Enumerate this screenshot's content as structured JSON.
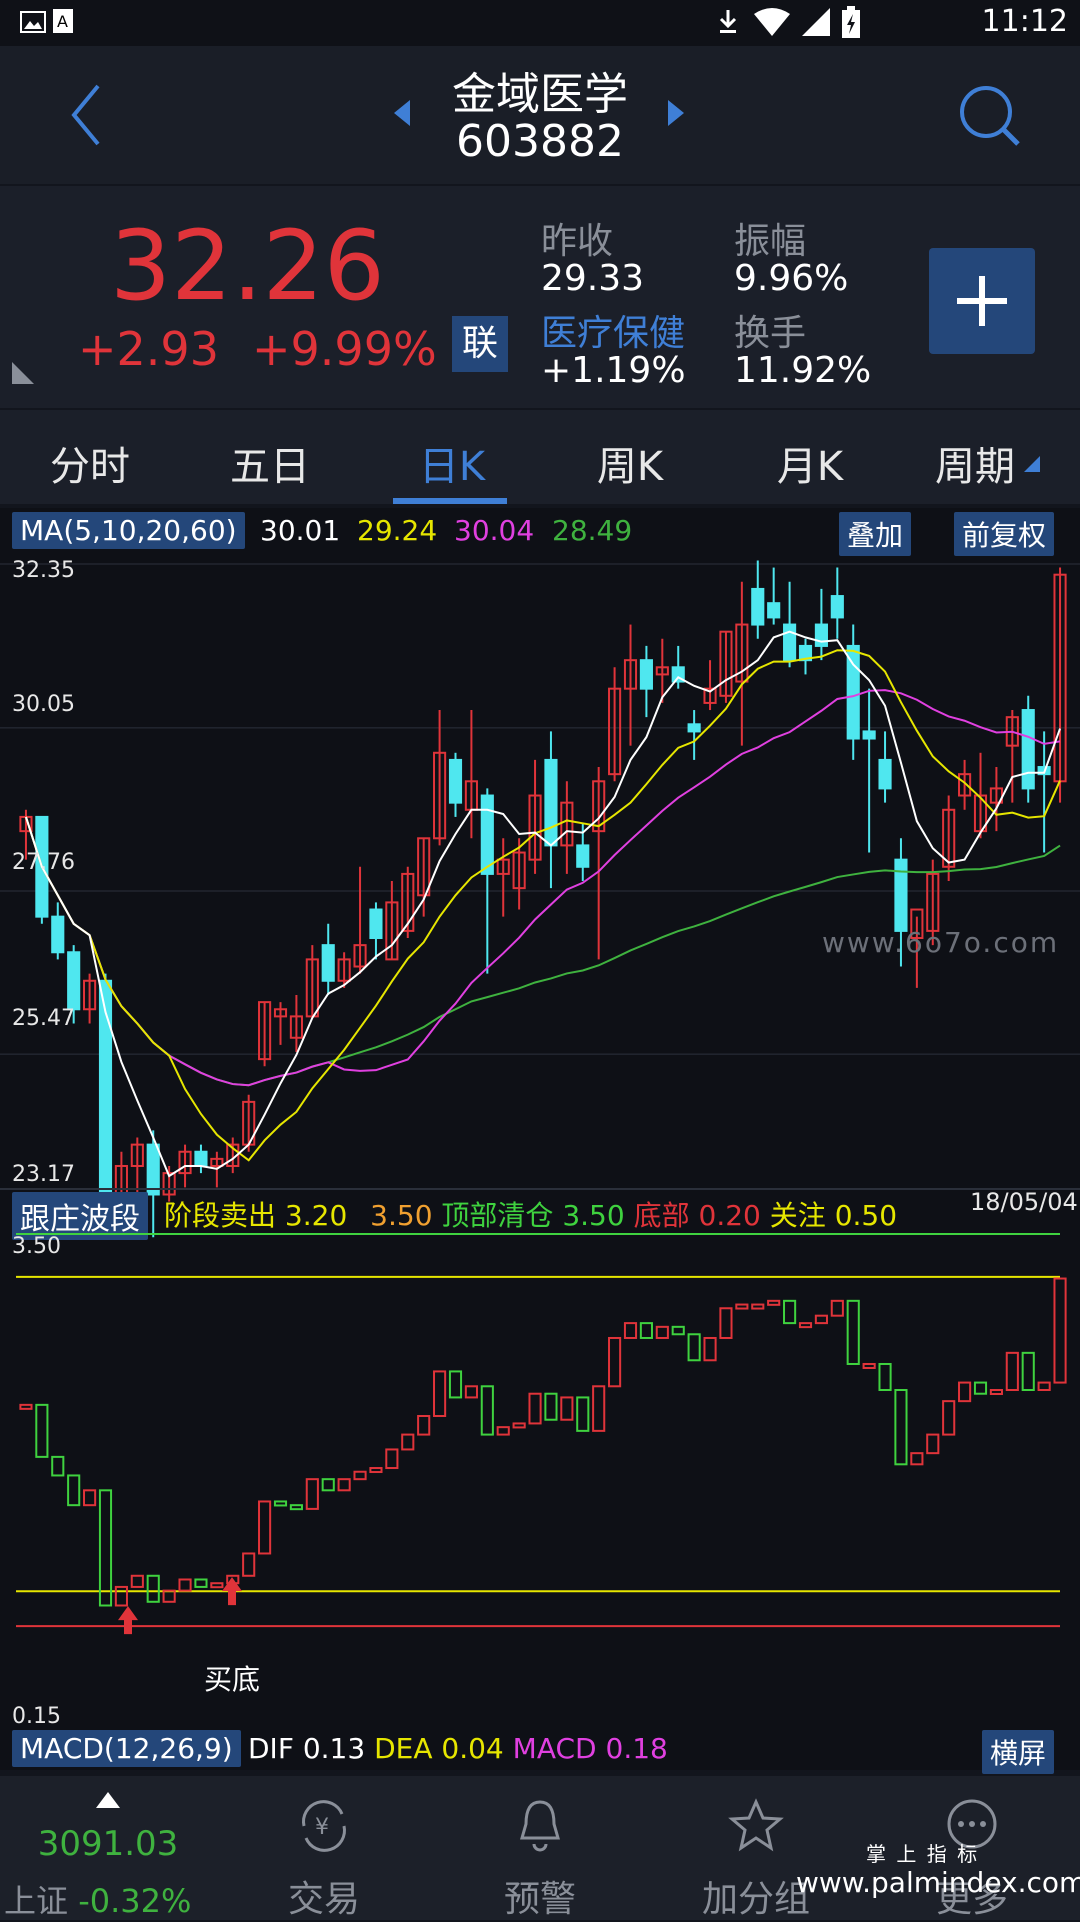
{
  "status": {
    "time": "11:12"
  },
  "header": {
    "stock_name": "金域医学",
    "stock_code": "603882"
  },
  "quote": {
    "price": "32.26",
    "change": "+2.93",
    "change_pct": "+9.99%",
    "lian_badge": "联",
    "prev_close_label": "昨收",
    "prev_close": "29.33",
    "amplitude_label": "振幅",
    "amplitude": "9.96%",
    "sector_label": "医疗保健",
    "sector_change": "+1.19%",
    "turnover_label": "换手",
    "turnover": "11.92%"
  },
  "tabs": [
    "分时",
    "五日",
    "日K",
    "周K",
    "月K",
    "周期"
  ],
  "active_tab": 2,
  "ma_bar": {
    "label": "MA(5,10,20,60)",
    "v1": "30.01",
    "v2": "29.24",
    "v3": "30.04",
    "v4": "28.49",
    "overlay_button": "叠加",
    "adjust_button": "前复权"
  },
  "price_axis": [
    "32.35",
    "30.05",
    "27.76",
    "25.47",
    "23.17"
  ],
  "watermark": "www.6o7o.com",
  "indicator_bar": {
    "label": "跟庄波段",
    "sell_label": "阶段卖出",
    "sell_a": "3.20",
    "sell_b": "3.50",
    "top_label": "顶部清仓",
    "top_val": "3.50",
    "bottom_label": "底部",
    "bottom_val": "0.20",
    "watch_label": "关注",
    "watch_val": "0.50",
    "date": "18/05/04"
  },
  "indicator_axis": [
    "3.50",
    "0.15"
  ],
  "buy_bottom_label": "买底",
  "macd_bar": {
    "label": "MACD(12,26,9)",
    "dif_label": "DIF",
    "dif": "0.13",
    "dea_label": "DEA",
    "dea": "0.04",
    "macd_label": "MACD",
    "macd": "0.18",
    "landscape_button": "横屏"
  },
  "bottom_nav": {
    "index_value": "3091.03",
    "index_name": "上证",
    "index_change": "-0.32%",
    "items": [
      "交易",
      "预警",
      "加分组",
      "更多"
    ]
  },
  "watermark_bottom": {
    "top": "掌 上 指 标",
    "url": "www.palmindex.com"
  },
  "chart_data": {
    "type": "candlestick",
    "ma_colors": {
      "ma5": "#ffffff",
      "ma10": "#e6e600",
      "ma20": "#e040e0",
      "ma60": "#3fb23f"
    },
    "up_color": "#e0343a",
    "down_color": "#4fe7ef",
    "y_range": [
      23.17,
      32.35
    ],
    "candles": [
      [
        28.6,
        28.9,
        28.2,
        28.8
      ],
      [
        28.8,
        28.8,
        27.3,
        27.4
      ],
      [
        27.4,
        27.6,
        26.8,
        26.9
      ],
      [
        26.9,
        27.0,
        25.9,
        26.1
      ],
      [
        26.1,
        26.6,
        25.9,
        26.5
      ],
      [
        26.5,
        26.6,
        22.9,
        23.4
      ],
      [
        23.4,
        24.1,
        23.0,
        23.9
      ],
      [
        23.9,
        24.3,
        23.4,
        24.2
      ],
      [
        24.2,
        24.4,
        22.9,
        23.5
      ],
      [
        23.5,
        23.9,
        23.4,
        23.8
      ],
      [
        23.8,
        24.2,
        23.6,
        24.1
      ],
      [
        24.1,
        24.2,
        23.8,
        23.9
      ],
      [
        23.9,
        24.1,
        23.6,
        24.0
      ],
      [
        23.9,
        24.3,
        23.8,
        24.2
      ],
      [
        24.2,
        24.9,
        24.1,
        24.8
      ],
      [
        25.4,
        26.2,
        25.3,
        26.2
      ],
      [
        26.0,
        26.2,
        25.6,
        26.1
      ],
      [
        25.7,
        26.3,
        25.5,
        26.0
      ],
      [
        26.0,
        27.0,
        26.0,
        26.8
      ],
      [
        27.0,
        27.3,
        26.3,
        26.5
      ],
      [
        26.5,
        26.9,
        26.4,
        26.8
      ],
      [
        26.7,
        28.1,
        26.6,
        27.0
      ],
      [
        27.5,
        27.6,
        26.8,
        27.1
      ],
      [
        26.8,
        27.9,
        26.8,
        27.6
      ],
      [
        27.2,
        28.1,
        27.1,
        28.0
      ],
      [
        27.7,
        28.5,
        27.4,
        28.5
      ],
      [
        28.5,
        30.3,
        28.4,
        29.7
      ],
      [
        29.6,
        29.7,
        28.8,
        29.0
      ],
      [
        28.9,
        30.3,
        28.5,
        29.3
      ],
      [
        29.1,
        29.2,
        26.6,
        28.0
      ],
      [
        28.0,
        28.5,
        27.4,
        28.2
      ],
      [
        27.8,
        28.5,
        27.5,
        28.3
      ],
      [
        28.2,
        29.6,
        28.0,
        29.1
      ],
      [
        29.6,
        30.0,
        27.8,
        28.4
      ],
      [
        28.4,
        29.3,
        28.0,
        29.0
      ],
      [
        28.4,
        28.7,
        27.9,
        28.1
      ],
      [
        28.6,
        29.5,
        26.8,
        29.3
      ],
      [
        29.4,
        30.9,
        29.3,
        30.6
      ],
      [
        30.6,
        31.5,
        29.8,
        31.0
      ],
      [
        31.0,
        31.2,
        30.2,
        30.6
      ],
      [
        30.8,
        31.3,
        30.4,
        30.9
      ],
      [
        30.9,
        31.2,
        30.6,
        30.7
      ],
      [
        30.1,
        30.3,
        29.6,
        30.0
      ],
      [
        30.4,
        31.0,
        30.3,
        30.6
      ],
      [
        30.5,
        31.4,
        30.4,
        31.4
      ],
      [
        30.7,
        32.1,
        29.8,
        31.5
      ],
      [
        32.0,
        32.4,
        31.3,
        31.5
      ],
      [
        31.8,
        32.3,
        31.5,
        31.6
      ],
      [
        31.5,
        32.1,
        30.9,
        31.0
      ],
      [
        31.2,
        31.3,
        30.8,
        31.0
      ],
      [
        31.5,
        32.0,
        31.0,
        31.2
      ],
      [
        31.9,
        32.3,
        31.3,
        31.6
      ],
      [
        31.2,
        31.5,
        29.6,
        29.9
      ],
      [
        30.0,
        30.6,
        28.3,
        29.9
      ],
      [
        29.6,
        30.0,
        29.0,
        29.2
      ],
      [
        28.2,
        28.5,
        26.7,
        27.2
      ],
      [
        27.1,
        27.4,
        26.4,
        27.5
      ],
      [
        27.2,
        28.2,
        27.0,
        28.0
      ],
      [
        28.1,
        29.1,
        27.9,
        28.9
      ],
      [
        29.1,
        29.6,
        28.9,
        29.4
      ],
      [
        28.6,
        29.7,
        28.5,
        29.1
      ],
      [
        29.0,
        29.5,
        28.6,
        29.2
      ],
      [
        29.8,
        30.3,
        29.0,
        30.2
      ],
      [
        30.3,
        30.5,
        29.0,
        29.2
      ],
      [
        29.5,
        30.0,
        28.3,
        29.4
      ],
      [
        29.3,
        32.3,
        29.0,
        32.2
      ]
    ]
  }
}
